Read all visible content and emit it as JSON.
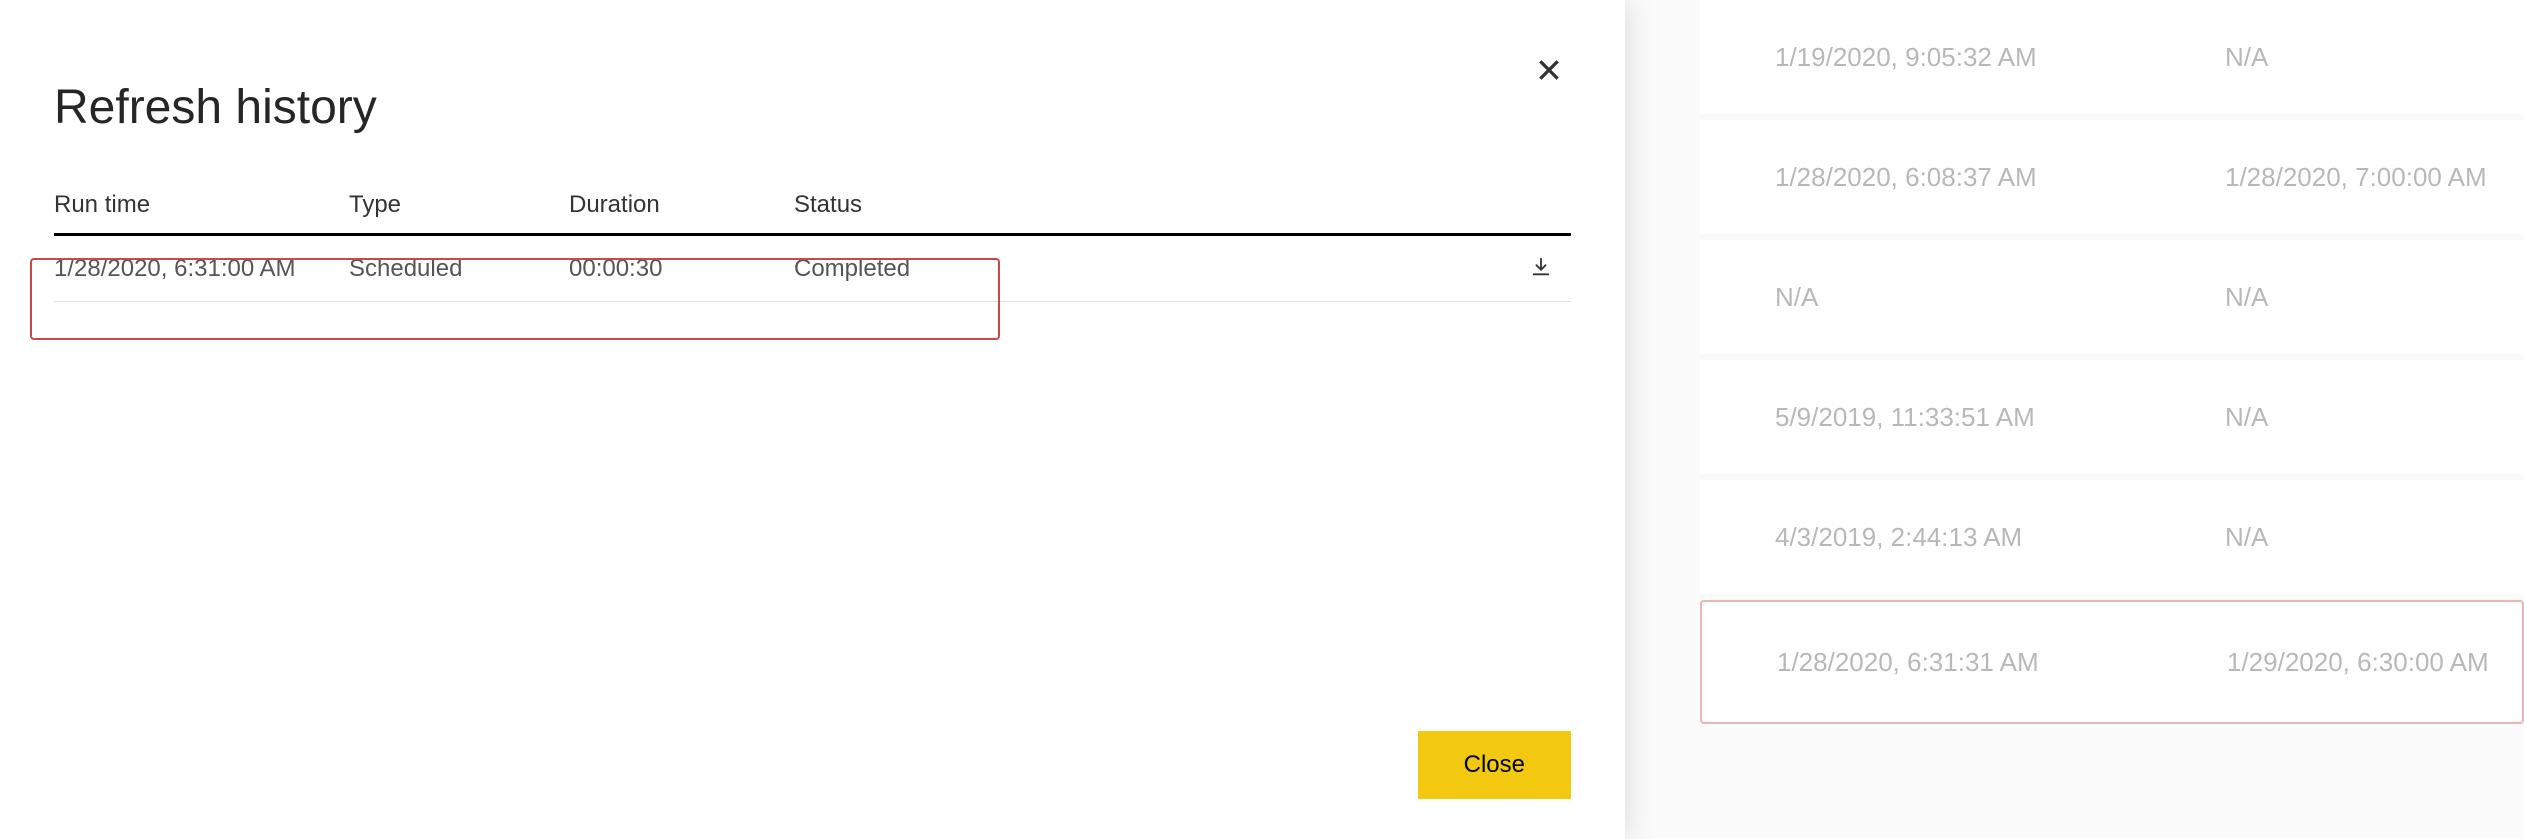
{
  "dialog": {
    "title": "Refresh history",
    "close_icon_label": "close",
    "close_btn_label": "Close",
    "columns": {
      "runtime": "Run time",
      "type": "Type",
      "duration": "Duration",
      "status": "Status"
    },
    "rows": [
      {
        "runtime": "1/28/2020, 6:31:00 AM",
        "type": "Scheduled",
        "duration": "00:00:30",
        "status": "Completed",
        "highlighted": true
      }
    ]
  },
  "bg_list": {
    "rows": [
      {
        "c1": "1/19/2020, 9:05:32 AM",
        "c2": "N/A",
        "highlighted": false
      },
      {
        "c1": "1/28/2020, 6:08:37 AM",
        "c2": "1/28/2020, 7:00:00 AM",
        "highlighted": false
      },
      {
        "c1": "N/A",
        "c2": "N/A",
        "highlighted": false
      },
      {
        "c1": "5/9/2019, 11:33:51 AM",
        "c2": "N/A",
        "highlighted": false
      },
      {
        "c1": "4/3/2019, 2:44:13 AM",
        "c2": "N/A",
        "highlighted": false
      },
      {
        "c1": "1/28/2020, 6:31:31 AM",
        "c2": "1/29/2020, 6:30:00 AM",
        "highlighted": true
      }
    ]
  }
}
